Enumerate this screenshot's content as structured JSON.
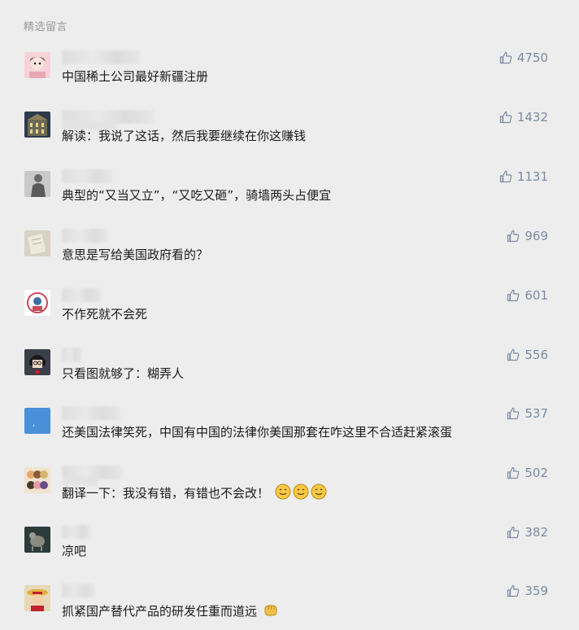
{
  "section_title": "精选留言",
  "colors": {
    "background": "#ededed",
    "like": "#7b8aa3",
    "text": "#1a1a1a",
    "muted": "#9a9a9a"
  },
  "comments": [
    {
      "text": "中国稀土公司最好新疆注册",
      "likes": "4750",
      "avatar": "anime-pink-avatar"
    },
    {
      "text": "解读：我说了这话，然后我要继续在你这赚钱",
      "likes": "1432",
      "avatar": "building-avatar"
    },
    {
      "text": "典型的“又当又立”，“又吃又砸”，骑墙两头占便宜",
      "likes": "1131",
      "avatar": "statue-avatar"
    },
    {
      "text": "意思是写给美国政府看的？",
      "likes": "969",
      "avatar": "paper-avatar"
    },
    {
      "text": "不作死就不会死",
      "likes": "601",
      "avatar": "cartoon-emblem-avatar"
    },
    {
      "text": "只看图就够了：糊弄人",
      "likes": "556",
      "avatar": "cartoon-character-avatar"
    },
    {
      "text": "还美国法律笑死，中国有中国的法律你美国那套在咋这里不合适赶紧滚蛋",
      "likes": "537",
      "avatar": "blue-avatar"
    },
    {
      "text": "翻译一下：我没有错，有错也不会改！",
      "likes": "502",
      "avatar": "anime-group-avatar",
      "emoji": [
        "smile-emoji",
        "smile-emoji",
        "smile-emoji"
      ]
    },
    {
      "text": "凉吧",
      "likes": "382",
      "avatar": "animal-avatar"
    },
    {
      "text": "抓紧国产替代产品的研发任重而道远",
      "likes": "359",
      "avatar": "luffy-avatar",
      "emoji": [
        "fist-emoji"
      ]
    }
  ]
}
